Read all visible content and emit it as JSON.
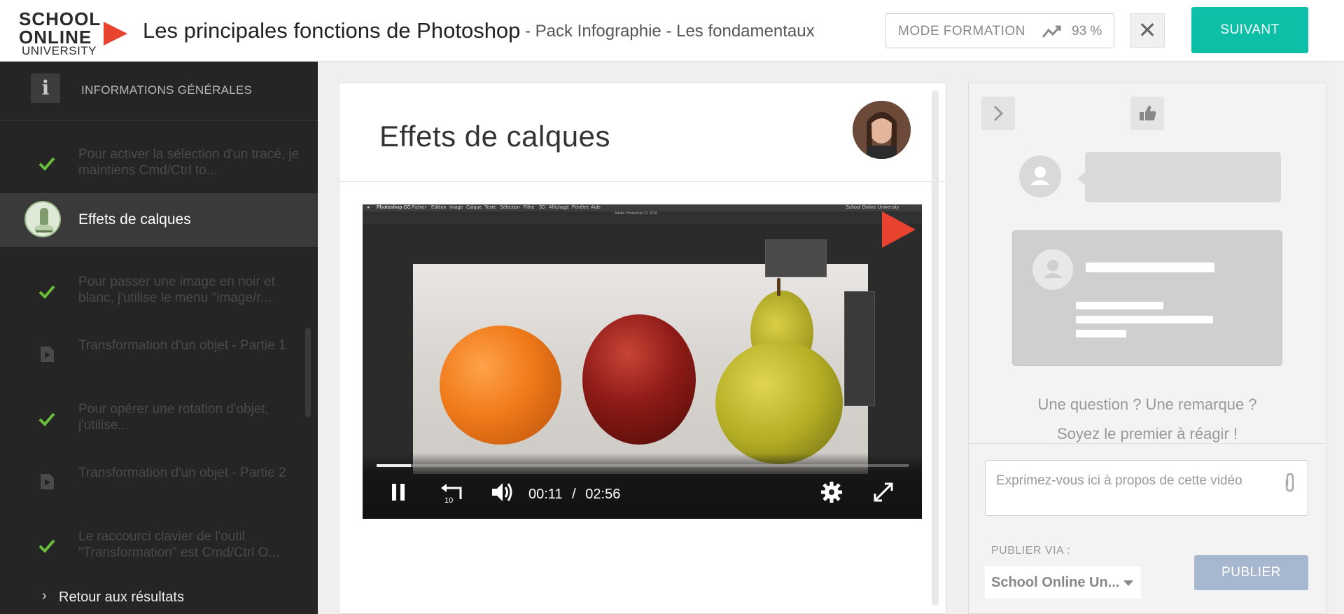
{
  "header": {
    "logo_line1": "SCHOOL",
    "logo_line2": "ONLINE",
    "logo_line3": "UNIVERSITY",
    "title": "Les principales fonctions de Photoshop",
    "subtitle": "- Pack Infographie - Les fondamentaux",
    "mode_label": "MODE FORMATION",
    "mode_icon": "trend-up-icon",
    "mode_percent": "93 %",
    "close_icon": "close-icon",
    "next_label": "SUIVANT",
    "accent_color": "#0cbfa6",
    "brand_color": "#e8432f"
  },
  "sidebar": {
    "info_label": "INFORMATIONS GÉNÉRALES",
    "lessons": [
      {
        "text": "Pour activer la sélection d'un tracé, je maintiens Cmd/Ctrl to...",
        "status": "done"
      },
      {
        "text": "Effets de calques",
        "status": "active"
      },
      {
        "text": "Pour passer une image en noir et blanc, j'utilise le menu \"image/r...",
        "status": "done"
      },
      {
        "text": "Transformation d'un objet - Partie 1",
        "status": "video"
      },
      {
        "text": "Pour opérer une rotation d'objet, j'utilise...",
        "status": "done"
      },
      {
        "text": "Transformation d'un objet - Partie 2",
        "status": "video"
      },
      {
        "text": "Le raccourci clavier de l'outil \"Transformation\" est Cmd/Ctrl O...",
        "status": "done"
      }
    ],
    "back_label": "Retour aux résultats",
    "check_color": "#6abf3c"
  },
  "main": {
    "title": "Effets de calques",
    "video": {
      "app_menu": [
        "Photoshop CC",
        "Fichier",
        "Edition",
        "Image",
        "Calque",
        "Texte",
        "Sélection",
        "Filtre",
        "3D",
        "Affichage",
        "Fenêtre",
        "Aide"
      ],
      "window_title": "Adobe Photoshop CC 2018",
      "menu_right": "School Online University",
      "current_time": "00:11",
      "duration": "02:56",
      "time_separator": "/",
      "progress": 0.065
    }
  },
  "comments": {
    "question_line1": "Une question ? Une remarque ?",
    "question_line2": "Soyez le premier à réagir !",
    "input_placeholder": "Exprimez-vous ici à propos de cette vidéo",
    "publish_via_label": "PUBLIER VIA :",
    "publish_via_value": "School Online Un...",
    "publish_label": "PUBLIER"
  }
}
